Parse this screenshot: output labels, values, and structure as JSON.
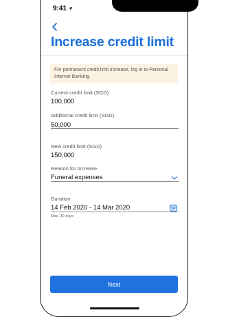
{
  "status_bar": {
    "time": "9:41"
  },
  "header": {
    "title": "Increase credit limit"
  },
  "info_banner": {
    "text": "For permanent credit limit increase, log in to Personal Internet Banking."
  },
  "fields": {
    "current_limit": {
      "label": "Current credit limit (SGD)",
      "value": "100,000"
    },
    "additional_limit": {
      "label": "Additional credit limit (SGD)",
      "value": "50,000"
    },
    "new_limit": {
      "label": "New credit limit (SGD)",
      "value": "150,000"
    },
    "reason": {
      "label": "Reason for increase",
      "value": "Funeral expenses"
    },
    "duration": {
      "label": "Duration",
      "value": "14 Feb 2020 - 14 Mar 2020",
      "helper": "Max. 30 days"
    }
  },
  "footer": {
    "next_label": "Next"
  },
  "icons": {
    "back": "chevron-left-icon",
    "dropdown": "chevron-down-icon",
    "calendar": "calendar-icon",
    "signal": "signal-icon",
    "wifi": "wifi-icon",
    "battery": "battery-icon",
    "location": "location-arrow-icon"
  },
  "colors": {
    "accent": "#1a6fd6",
    "button": "#1f72e0",
    "banner_bg": "#fdf3e3"
  }
}
